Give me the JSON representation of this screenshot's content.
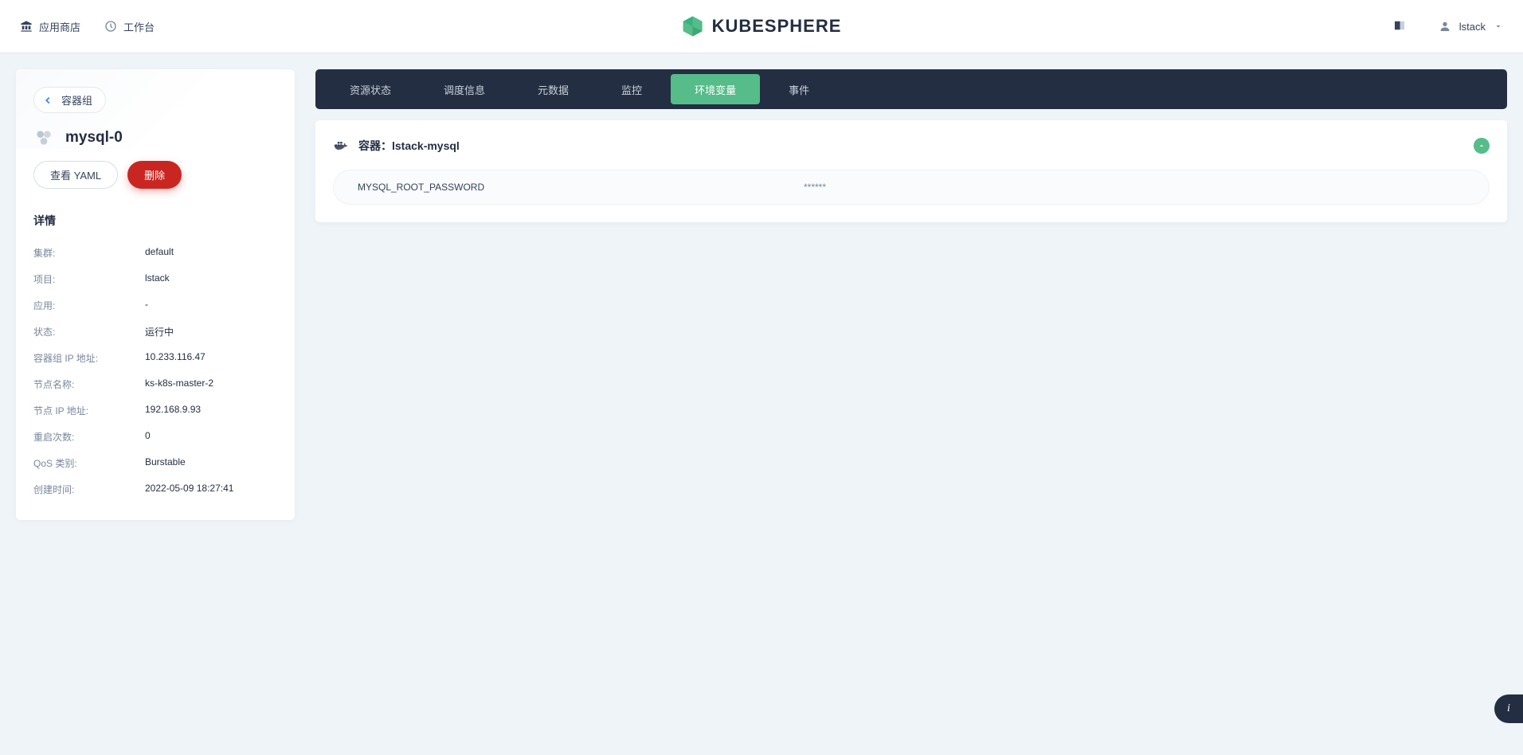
{
  "header": {
    "app_store": "应用商店",
    "workbench": "工作台",
    "brand": "KUBESPHERE",
    "username": "lstack"
  },
  "sidebar": {
    "back_label": "容器组",
    "pod_name": "mysql-0",
    "view_yaml": "查看 YAML",
    "delete": "删除",
    "details_title": "详情",
    "rows": [
      {
        "label": "集群:",
        "value": "default"
      },
      {
        "label": "项目:",
        "value": "lstack"
      },
      {
        "label": "应用:",
        "value": "-"
      },
      {
        "label": "状态:",
        "value": "运行中"
      },
      {
        "label": "容器组 IP 地址:",
        "value": "10.233.116.47"
      },
      {
        "label": "节点名称:",
        "value": "ks-k8s-master-2"
      },
      {
        "label": "节点 IP 地址:",
        "value": "192.168.9.93"
      },
      {
        "label": "重启次数:",
        "value": "0"
      },
      {
        "label": "QoS 类别:",
        "value": "Burstable"
      },
      {
        "label": "创建时间:",
        "value": "2022-05-09 18:27:41"
      }
    ]
  },
  "tabs": [
    {
      "label": "资源状态",
      "active": false
    },
    {
      "label": "调度信息",
      "active": false
    },
    {
      "label": "元数据",
      "active": false
    },
    {
      "label": "监控",
      "active": false
    },
    {
      "label": "环境变量",
      "active": true
    },
    {
      "label": "事件",
      "active": false
    }
  ],
  "container": {
    "title": "容器：lstack-mysql",
    "env": {
      "key": "MYSQL_ROOT_PASSWORD",
      "value": "******"
    }
  }
}
